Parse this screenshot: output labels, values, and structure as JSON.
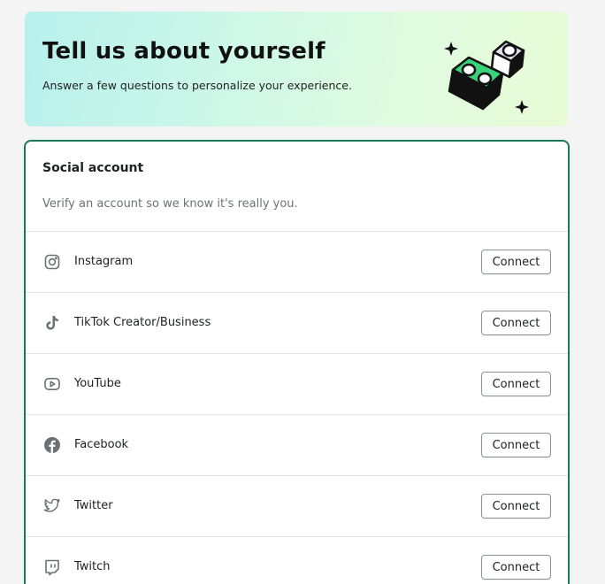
{
  "hero": {
    "title": "Tell us about yourself",
    "subtitle": "Answer a few questions to personalize your experience."
  },
  "card": {
    "title": "Social account",
    "description": "Verify an account so we know it's really you.",
    "accounts": [
      {
        "label": "Instagram",
        "icon": "instagram-icon",
        "button": "Connect"
      },
      {
        "label": "TikTok Creator/Business",
        "icon": "tiktok-icon",
        "button": "Connect"
      },
      {
        "label": "YouTube",
        "icon": "youtube-icon",
        "button": "Connect"
      },
      {
        "label": "Facebook",
        "icon": "facebook-icon",
        "button": "Connect"
      },
      {
        "label": "Twitter",
        "icon": "twitter-icon",
        "button": "Connect"
      },
      {
        "label": "Twitch",
        "icon": "twitch-icon",
        "button": "Connect"
      }
    ]
  },
  "colors": {
    "card_border": "#1b7a5a",
    "hero_gradient_start": "#b8f0ec",
    "hero_gradient_end": "#e8fbd6",
    "icon_gray": "#6d7175"
  }
}
